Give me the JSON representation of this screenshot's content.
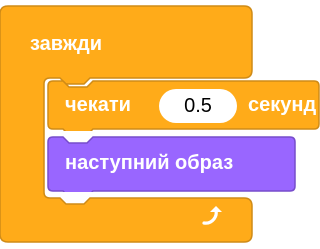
{
  "blocks": {
    "forever": {
      "label": "завжди",
      "color": "#FFAB19",
      "border_color": "#CF8B17",
      "loop_icon": "loop-arrow-icon"
    },
    "wait": {
      "label": "чекати",
      "value": "0.5",
      "unit": "секунд",
      "color": "#FFAB19"
    },
    "next_costume": {
      "label": "наступний  образ",
      "color": "#9966FF",
      "border_color": "#774DCB"
    }
  }
}
